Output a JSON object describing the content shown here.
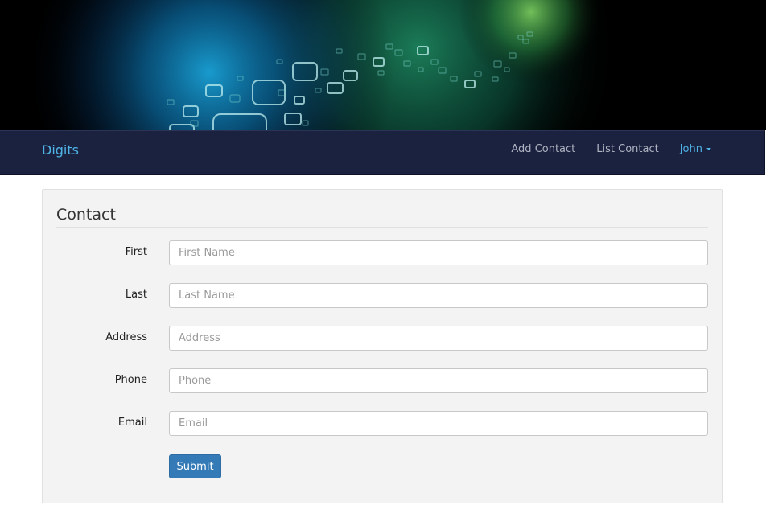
{
  "colors": {
    "navbar_bg": "#1b2240",
    "brand": "#4fb3e6",
    "nav_link": "#aeb3c0",
    "primary_button": "#337ab7"
  },
  "navbar": {
    "brand": "Digits",
    "links": [
      "Add Contact",
      "List Contact"
    ],
    "user": "John"
  },
  "form": {
    "legend": "Contact",
    "fields": [
      {
        "label": "First",
        "placeholder": "First Name",
        "value": ""
      },
      {
        "label": "Last",
        "placeholder": "Last Name",
        "value": ""
      },
      {
        "label": "Address",
        "placeholder": "Address",
        "value": ""
      },
      {
        "label": "Phone",
        "placeholder": "Phone",
        "value": ""
      },
      {
        "label": "Email",
        "placeholder": "Email",
        "value": ""
      }
    ],
    "submit_label": "Submit"
  }
}
